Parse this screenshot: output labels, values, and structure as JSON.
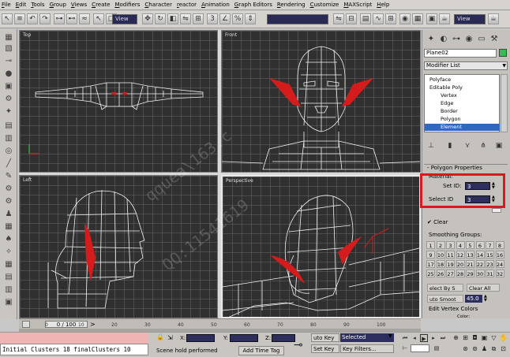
{
  "menu": [
    "File",
    "Edit",
    "Tools",
    "Group",
    "Views",
    "Create",
    "Modifiers",
    "Character",
    "reactor",
    "Animation",
    "Graph Editors",
    "Rendering",
    "Customize",
    "MAXScript",
    "Help"
  ],
  "toolbar": {
    "view_dropdown": "View",
    "view_dropdown2": "View"
  },
  "viewports": {
    "top_label": "Top",
    "front_label": "Front",
    "left_label": "Left",
    "perspective_label": "Perspective"
  },
  "watermarks": [
    "qquea\\163.c",
    "QQ:11541619"
  ],
  "command_panel": {
    "object_name": "Plane02",
    "object_color": "#2fc050",
    "modifier_list": "Modifier List",
    "stack": [
      "Polyface",
      "Editable Poly",
      "Vertex",
      "Edge",
      "Border",
      "Polygon",
      "Element"
    ],
    "stack_selected_index": 6,
    "rollout_title": "Polygon Properties",
    "material_label": "Material:",
    "set_id_label": "Set ID:",
    "set_id_value": "3",
    "select_id_label": "Select ID",
    "select_id_value": "3",
    "clear_label": "Clear",
    "smoothing_groups_label": "Smoothing Groups:",
    "smoothing_groups": [
      "1",
      "2",
      "3",
      "4",
      "5",
      "6",
      "7",
      "8",
      "9",
      "10",
      "11",
      "12",
      "13",
      "14",
      "15",
      "16",
      "17",
      "18",
      "19",
      "20",
      "21",
      "22",
      "23",
      "24",
      "25",
      "26",
      "27",
      "28",
      "29",
      "30",
      "31",
      "32"
    ],
    "select_by_sg": "elect By S",
    "clear_all": "Clear All",
    "auto_smooth": "uto Smoot",
    "auto_smooth_value": "45.0",
    "edit_vertex_colors": "Edit Vertex Colors",
    "color_label": "Color:"
  },
  "timeline": {
    "position": "0 / 100",
    "ticks": [
      "0",
      "10",
      "20",
      "30",
      "40",
      "50",
      "60",
      "70",
      "80",
      "90",
      "100"
    ]
  },
  "status": {
    "listener_line": "Initial Clusters 18 finalClusters 10",
    "prompt": "Scene hold performed",
    "add_time_tag": "Add Time Tag",
    "x_label": "X:",
    "y_label": "Y:",
    "z_label": "Z:",
    "auto_key": "uto Key",
    "selected": "Selected",
    "set_key": "Set Key",
    "key_filters": "Key Filters..."
  }
}
